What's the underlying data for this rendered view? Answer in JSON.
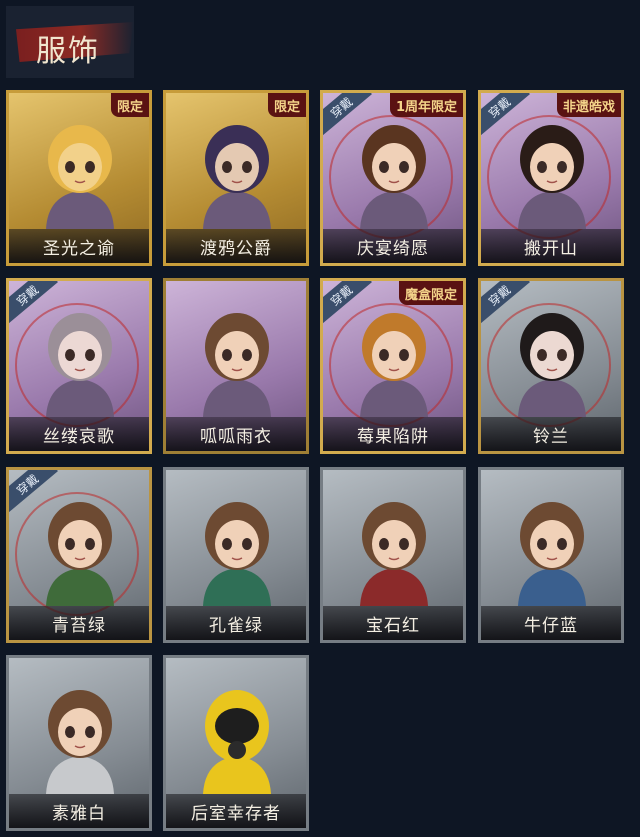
{
  "page": {
    "title": "服饰"
  },
  "colors": {
    "accent": "#8c2a24",
    "gold_frame": "#c79c3a",
    "purple_frame": "#9a7aac",
    "grey_frame": "#858c93"
  },
  "items": [
    {
      "name": "圣光之谕",
      "tag": "限定",
      "equipped": "",
      "frame": "gold",
      "icon": "saint-light-avatar-icon",
      "avatar_color": "#f2d18a",
      "hair_color": "#e8b84b"
    },
    {
      "name": "渡鸦公爵",
      "tag": "限定",
      "equipped": "",
      "frame": "gold",
      "icon": "raven-duke-avatar-icon",
      "avatar_color": "#e4c9b2",
      "hair_color": "#3a2f56"
    },
    {
      "name": "庆宴绮愿",
      "tag": "1周年限定",
      "equipped": "穿戴",
      "frame": "purple",
      "icon": "anniversary-avatar-icon",
      "avatar_color": "#f0d1b8",
      "hair_color": "#5a3520"
    },
    {
      "name": "搬开山",
      "tag": "非遗皓戏",
      "equipped": "穿戴",
      "frame": "purple",
      "icon": "opera-avatar-icon",
      "avatar_color": "#f0d1b8",
      "hair_color": "#2a1c17"
    },
    {
      "name": "丝缕哀歌",
      "tag": "",
      "equipped": "穿戴",
      "frame": "purple",
      "icon": "lace-elegy-avatar-icon",
      "avatar_color": "#ecd8d4",
      "hair_color": "#9b8f98"
    },
    {
      "name": "呱呱雨衣",
      "tag": "",
      "equipped": "",
      "frame": "purple",
      "icon": "frog-raincoat-avatar-icon",
      "avatar_color": "#f0d1b8",
      "hair_color": "#6d4a32"
    },
    {
      "name": "莓果陷阱",
      "tag": "魔盒限定",
      "equipped": "穿戴",
      "frame": "purple",
      "icon": "berry-trap-avatar-icon",
      "avatar_color": "#f0d1b8",
      "hair_color": "#c07a2b"
    },
    {
      "name": "铃兰",
      "tag": "",
      "equipped": "穿戴",
      "frame": "grey",
      "icon": "lily-avatar-icon",
      "avatar_color": "#ecd9d2",
      "hair_color": "#1f1a1a"
    },
    {
      "name": "青苔绿",
      "tag": "",
      "equipped": "穿戴",
      "frame": "grey",
      "icon": "moss-green-avatar-icon",
      "avatar_color": "#f0d1b8",
      "hair_color": "#6d4a32",
      "shirt_color": "#3f6b3a"
    },
    {
      "name": "孔雀绿",
      "tag": "",
      "equipped": "",
      "frame": "grey",
      "icon": "peacock-green-avatar-icon",
      "avatar_color": "#f0d1b8",
      "hair_color": "#6d4a32",
      "shirt_color": "#2f6f56"
    },
    {
      "name": "宝石红",
      "tag": "",
      "equipped": "",
      "frame": "grey",
      "icon": "gem-red-avatar-icon",
      "avatar_color": "#f0d1b8",
      "hair_color": "#6d4a32",
      "shirt_color": "#8b2a2a"
    },
    {
      "name": "牛仔蓝",
      "tag": "",
      "equipped": "",
      "frame": "grey",
      "icon": "denim-blue-avatar-icon",
      "avatar_color": "#f0d1b8",
      "hair_color": "#6d4a32",
      "shirt_color": "#3a5f8e"
    },
    {
      "name": "素雅白",
      "tag": "",
      "equipped": "",
      "frame": "grey",
      "icon": "plain-white-avatar-icon",
      "avatar_color": "#f0d1b8",
      "hair_color": "#6d4a32",
      "shirt_color": "#c7c9cc"
    },
    {
      "name": "后室幸存者",
      "tag": "",
      "equipped": "",
      "frame": "grey",
      "icon": "backrooms-survivor-avatar-icon",
      "avatar_color": "#1e1e1e",
      "hair_color": "#e9c51d",
      "shirt_color": "#e9c51d"
    }
  ]
}
